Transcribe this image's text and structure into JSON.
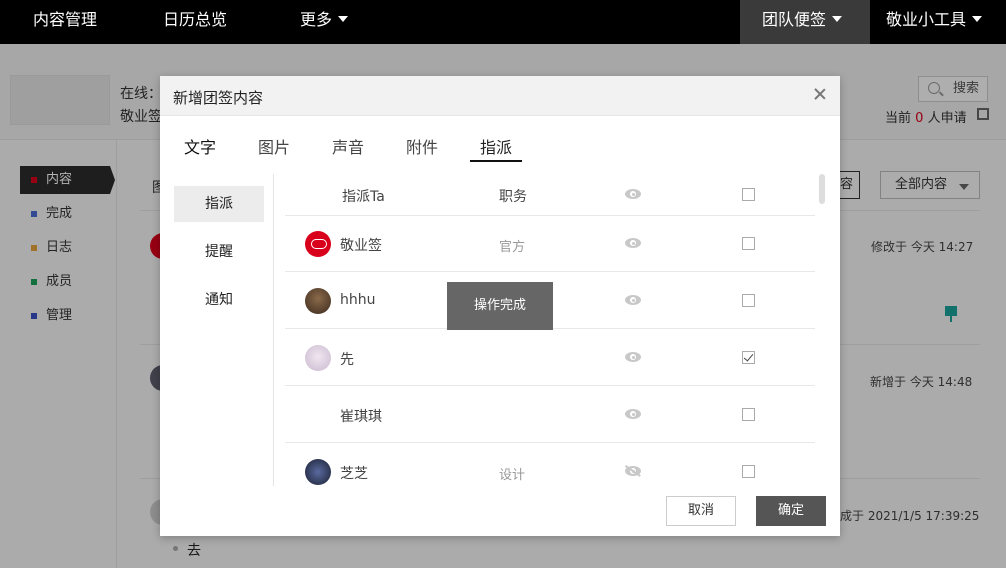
{
  "topnav": {
    "items": [
      "内容管理",
      "日历总览",
      "更多"
    ],
    "active_item": "团队便签",
    "tools": "敬业小工具"
  },
  "header": {
    "online_label": "在线：",
    "name_fragment": "敬业签",
    "search_label": "搜索",
    "applicants_prefix": "当前",
    "applicants_count": "0",
    "applicants_suffix": "人申请"
  },
  "sidebar": {
    "items": [
      {
        "label": "内容",
        "color": "#d9001b"
      },
      {
        "label": "完成",
        "color": "#4a6cd4"
      },
      {
        "label": "日志",
        "color": "#e6a23c"
      },
      {
        "label": "成员",
        "color": "#1aa35a"
      },
      {
        "label": "管理",
        "color": "#3b4fc4"
      }
    ]
  },
  "main": {
    "filter_label": "全部内容",
    "button_edge": "容",
    "row1_time": "修改于 今天 14:27",
    "row2_time": "新增于 今天 14:48",
    "row3_time": "成于 2021/1/5 17:39:25",
    "row3_text": "去",
    "header_fragment": "图"
  },
  "modal": {
    "title": "新增团签内容",
    "tabs": [
      "文字",
      "图片",
      "声音",
      "附件",
      "指派"
    ],
    "active_tab": "指派",
    "subnav": [
      "指派",
      "提醒",
      "通知"
    ],
    "active_subnav": "指派",
    "list_header": {
      "name": "指派Ta",
      "role": "职务"
    },
    "members": [
      {
        "name": "敬业签",
        "role": "官方",
        "avatar": "red-cloud",
        "visible": true,
        "checked": false
      },
      {
        "name": "hhhu",
        "role": "",
        "avatar": "brown-photo",
        "visible": true,
        "checked": false
      },
      {
        "name": "先",
        "role": "",
        "avatar": "pale-photo",
        "visible": true,
        "checked": true
      },
      {
        "name": "崔琪琪",
        "role": "",
        "avatar": "none",
        "visible": true,
        "checked": false
      },
      {
        "name": "芝芝",
        "role": "设计",
        "avatar": "space-photo",
        "visible": false,
        "checked": false
      }
    ],
    "toast": "操作完成",
    "cancel_label": "取消",
    "confirm_label": "确定"
  }
}
